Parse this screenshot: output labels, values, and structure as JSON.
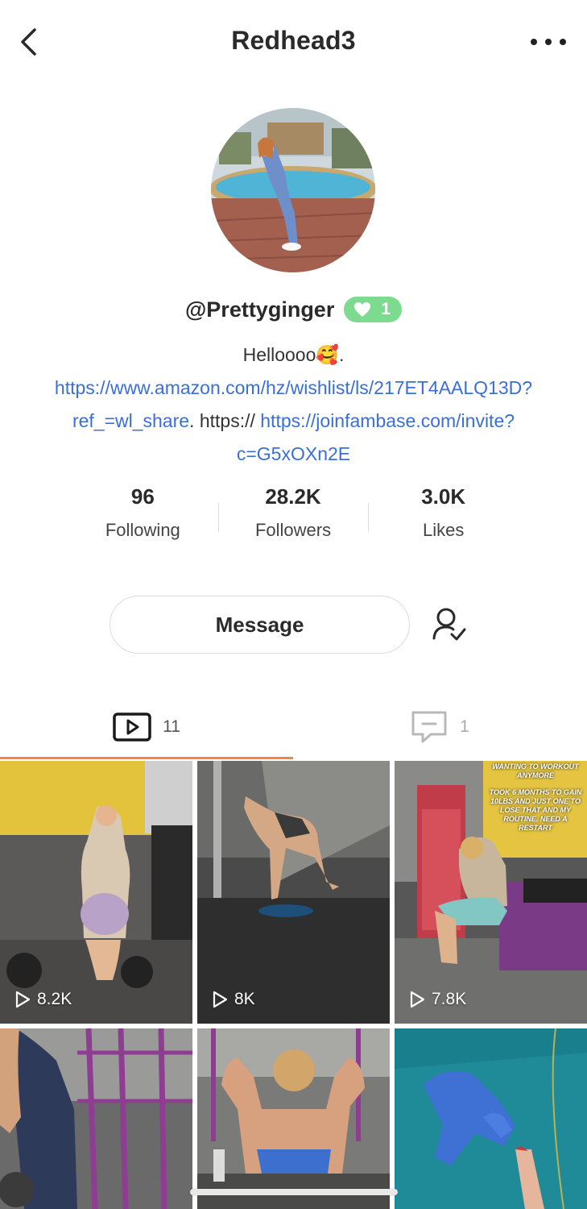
{
  "header": {
    "title": "Redhead3",
    "back_icon": "chevron-left-icon",
    "more_icon": "more-horizontal-icon"
  },
  "profile": {
    "handle": "@Prettyginger",
    "badge_icon": "heart-icon",
    "badge_count": "1",
    "bio": {
      "prefix": "Helloooo",
      "emoji": "🥰",
      "sep": ". ",
      "link1": "https://www.amazon.com/hz/wishlist/ls/217ET4AALQ13D?ref_=wl_share",
      "mid": ". https:// ",
      "link2": "https://joinfambase.com/invite?c=G5xOXn2E"
    }
  },
  "stats": [
    {
      "value": "96",
      "label": "Following"
    },
    {
      "value": "28.2K",
      "label": "Followers"
    },
    {
      "value": "3.0K",
      "label": "Likes"
    }
  ],
  "actions": {
    "message_label": "Message",
    "follow_icon": "user-check-icon"
  },
  "tabs": [
    {
      "icon": "video-play-icon",
      "count": "11",
      "active": true
    },
    {
      "icon": "comment-icon",
      "count": "1",
      "active": false
    }
  ],
  "colors": {
    "accent": "#f4853f",
    "link": "#3a6fd8",
    "badge": "#7ddb8f"
  },
  "videos": [
    {
      "views": "8.2K"
    },
    {
      "views": "8K"
    },
    {
      "views": "7.8K",
      "caption_title": "WANTING TO WORKOUT ANYMORE",
      "caption_body": "TOOK 6 MONTHS TO GAIN 10LBS AND JUST ONE TO LOSE THAT AND MY ROUTINE. NEED A RESTART"
    },
    {
      "views": ""
    },
    {
      "views": ""
    },
    {
      "views": ""
    }
  ]
}
